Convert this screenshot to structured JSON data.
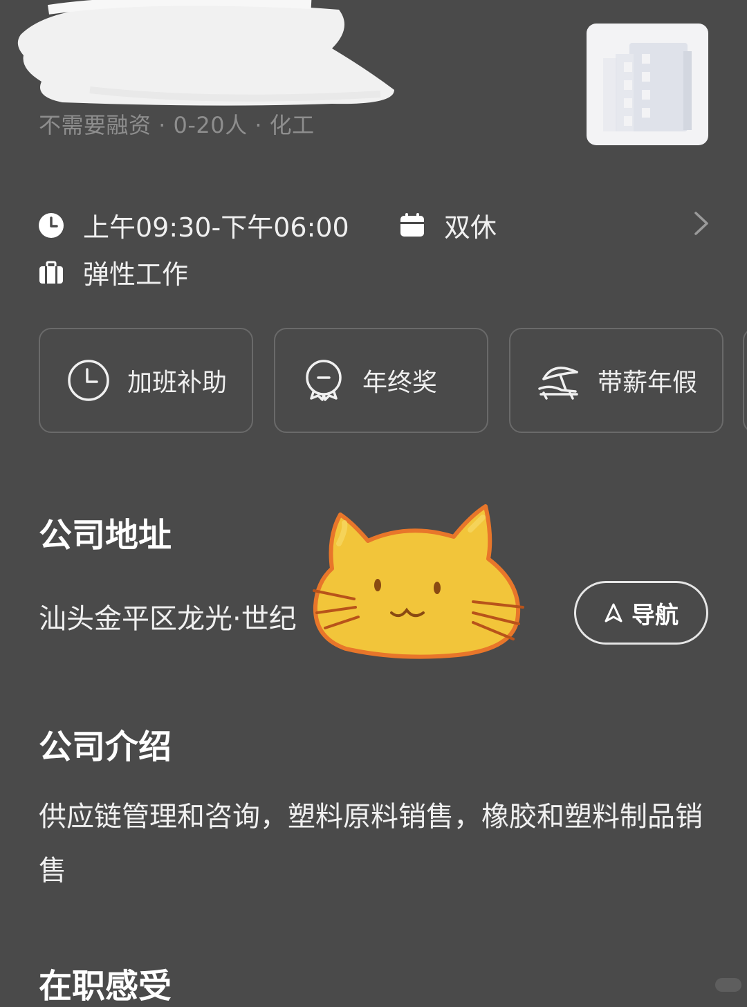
{
  "company": {
    "meta": "不需要融资 · 0-20人 · 化工",
    "logo_icon": "building-icon"
  },
  "work_info": {
    "hours_icon": "clock-icon",
    "hours": "上午09:30-下午06:00",
    "rest_icon": "calendar-icon",
    "rest": "双休",
    "flex_icon": "briefcase-icon",
    "flex": "弹性工作",
    "more_icon": "chevron-right-icon"
  },
  "benefits": [
    {
      "icon": "clock-icon",
      "label": "加班补助"
    },
    {
      "icon": "medal-icon",
      "label": "年终奖"
    },
    {
      "icon": "beach-umbrella-icon",
      "label": "带薪年假"
    }
  ],
  "address_section": {
    "title": "公司地址",
    "address": "汕头金平区龙光·世纪",
    "nav_label": "导航",
    "nav_icon": "navigation-arrow-icon"
  },
  "intro_section": {
    "title": "公司介绍",
    "text": "供应链管理和咨询，塑料原料销售，橡胶和塑料制品销售"
  },
  "feel_section": {
    "title": "在职感受"
  },
  "colors": {
    "background": "#4a4a4a",
    "text": "#f0f0f0",
    "muted_text": "#8e8e8e",
    "card_border": "#6a6a6a",
    "logo_bg": "#f3f3f5",
    "cat_fill": "#f2c53a",
    "cat_outline": "#e8762a"
  }
}
